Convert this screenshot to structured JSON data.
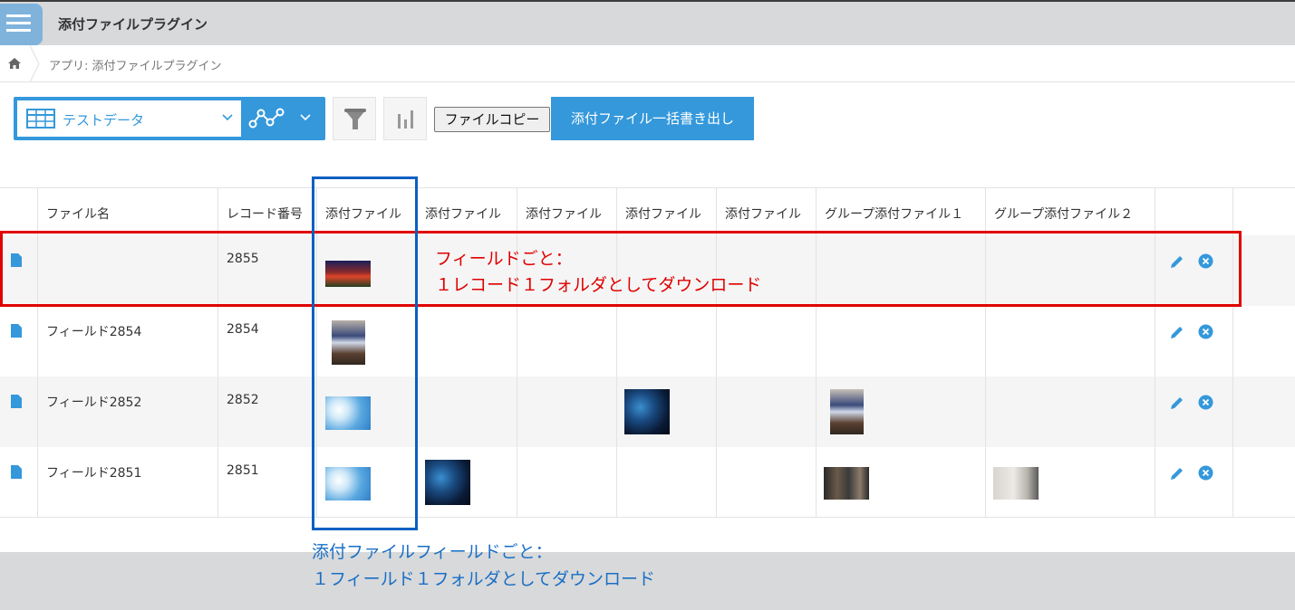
{
  "header": {
    "app_title": "添付ファイルプラグイン"
  },
  "breadcrumb": {
    "path": "アプリ: 添付ファイルプラグイン"
  },
  "toolbar": {
    "view_name": "テストデータ",
    "copy_button": "ファイルコピー",
    "export_button": "添付ファイル一括書き出し"
  },
  "table": {
    "headers": [
      "",
      "ファイル名",
      "レコード番号",
      "添付ファイル",
      "添付ファイル",
      "添付ファイル",
      "添付ファイル",
      "添付ファイル",
      "グループ添付ファイル１",
      "グループ添付ファイル２",
      ""
    ],
    "rows": [
      {
        "name": "",
        "record": "2855"
      },
      {
        "name": "フィールド2854",
        "record": "2854"
      },
      {
        "name": "フィールド2852",
        "record": "2852"
      },
      {
        "name": "フィールド2851",
        "record": "2851"
      }
    ]
  },
  "annotations": {
    "red_line1": "フィールドごと：",
    "red_line2": "１レコード１フォルダとしてダウンロード",
    "blue_line1": "添付ファイルフィールドごと：",
    "blue_line2": "１フィールド１フォルダとしてダウンロード"
  },
  "colors": {
    "accent": "#3498db",
    "annotation_red": "#e00000",
    "annotation_blue": "#0a60c2"
  },
  "icons": [
    "app-menu-icon",
    "home-icon",
    "table-icon",
    "chevron-down-icon",
    "graph-icon",
    "filter-icon",
    "bar-chart-icon",
    "document-icon",
    "pencil-icon",
    "close-circle-icon"
  ]
}
